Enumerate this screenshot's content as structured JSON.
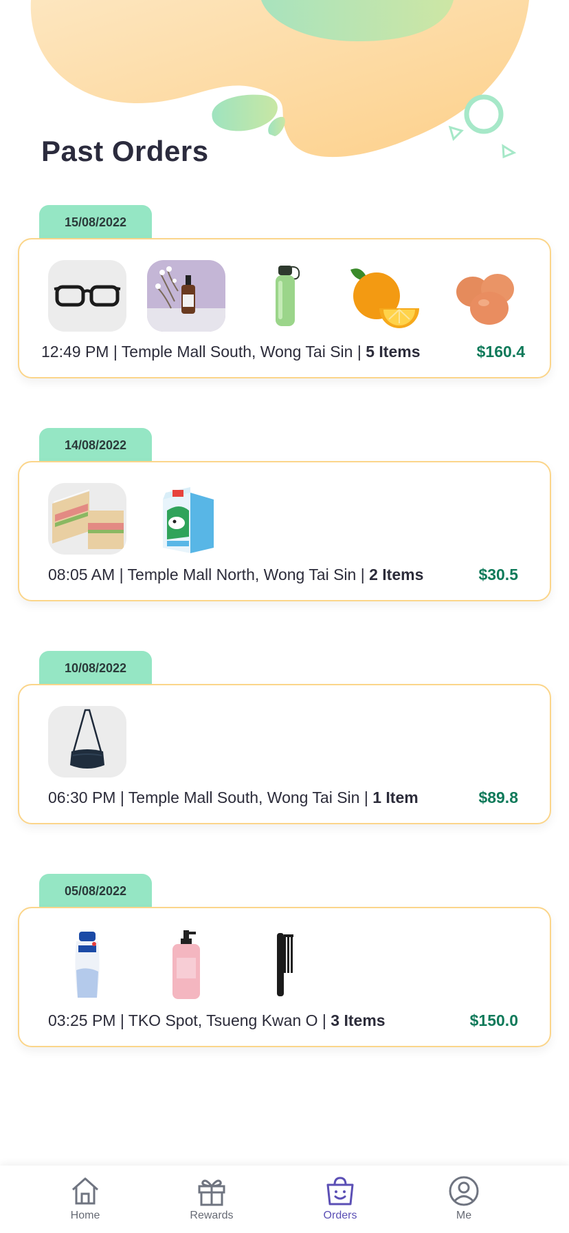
{
  "page": {
    "title": "Past Orders"
  },
  "orders": [
    {
      "date": "15/08/2022",
      "time": "12:49 PM",
      "location": "Temple Mall South, Wong Tai Sin",
      "items_label": "5 Items",
      "price": "$160.4",
      "item_icons": [
        "glasses-icon",
        "serum-bottle-icon",
        "water-bottle-icon",
        "orange-icon",
        "eggs-icon"
      ]
    },
    {
      "date": "14/08/2022",
      "time": "08:05 AM",
      "location": "Temple Mall North, Wong Tai Sin",
      "items_label": "2 Items",
      "price": "$30.5",
      "item_icons": [
        "sandwich-icon",
        "milk-carton-icon"
      ]
    },
    {
      "date": "10/08/2022",
      "time": "06:30 PM",
      "location": "Temple Mall South, Wong Tai Sin",
      "items_label": "1 Item",
      "price": "$89.8",
      "item_icons": [
        "crossbody-bag-icon"
      ]
    },
    {
      "date": "05/08/2022",
      "time": "03:25 PM",
      "location": "TKO Spot, Tsueng Kwan O",
      "items_label": "3 Items",
      "price": "$150.0",
      "item_icons": [
        "shampoo-icon",
        "body-wash-icon",
        "comb-icon"
      ]
    }
  ],
  "tabbar": {
    "items": [
      {
        "label": "Home",
        "icon": "home-icon"
      },
      {
        "label": "Rewards",
        "icon": "gift-icon"
      },
      {
        "label": "Orders",
        "icon": "shopping-basket-icon",
        "active": true
      },
      {
        "label": "Me",
        "icon": "user-icon"
      }
    ]
  },
  "colors": {
    "accent": "#5b4fb5",
    "price_green": "#0f7a5a",
    "date_tab": "#95e6c4",
    "card_border": "#fbd58a"
  }
}
